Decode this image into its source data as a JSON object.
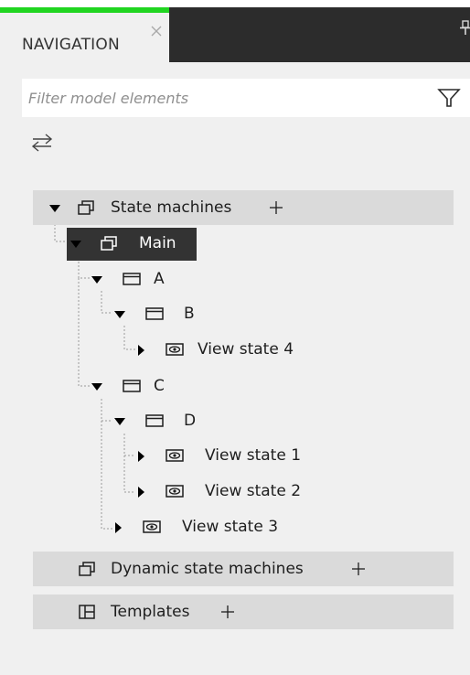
{
  "tabs": {
    "active_label": "NAVIGATION",
    "accent_color": "#21d521"
  },
  "filter": {
    "placeholder": "Filter model elements"
  },
  "tree": {
    "state_machines": {
      "label": "State machines",
      "expanded": true
    },
    "main": {
      "label": "Main",
      "selected": true
    },
    "a": {
      "label": "A"
    },
    "b": {
      "label": "B"
    },
    "view_state_4": {
      "label": "View state 4"
    },
    "c": {
      "label": "C"
    },
    "d": {
      "label": "D"
    },
    "view_state_1": {
      "label": "View state 1"
    },
    "view_state_2": {
      "label": "View state 2"
    },
    "view_state_3": {
      "label": "View state 3"
    },
    "dynamic_state_machines": {
      "label": "Dynamic state machines"
    },
    "templates": {
      "label": "Templates"
    }
  },
  "colors": {
    "panel_background": "#f0f0f0",
    "section_bar": "#dadada",
    "selected_background": "#333333",
    "tabbar_dark": "#2c2c2c"
  },
  "icons": {
    "tab_close": "close-icon",
    "pin": "pin-icon",
    "filter": "funnel-icon",
    "swap": "swap-arrows-icon",
    "expand": "triangle-down-icon",
    "collapse": "triangle-right-icon",
    "state_machine": "state-machine-icon",
    "state": "state-icon",
    "view_state": "eye-icon",
    "template": "template-icon",
    "add": "plus-icon"
  }
}
